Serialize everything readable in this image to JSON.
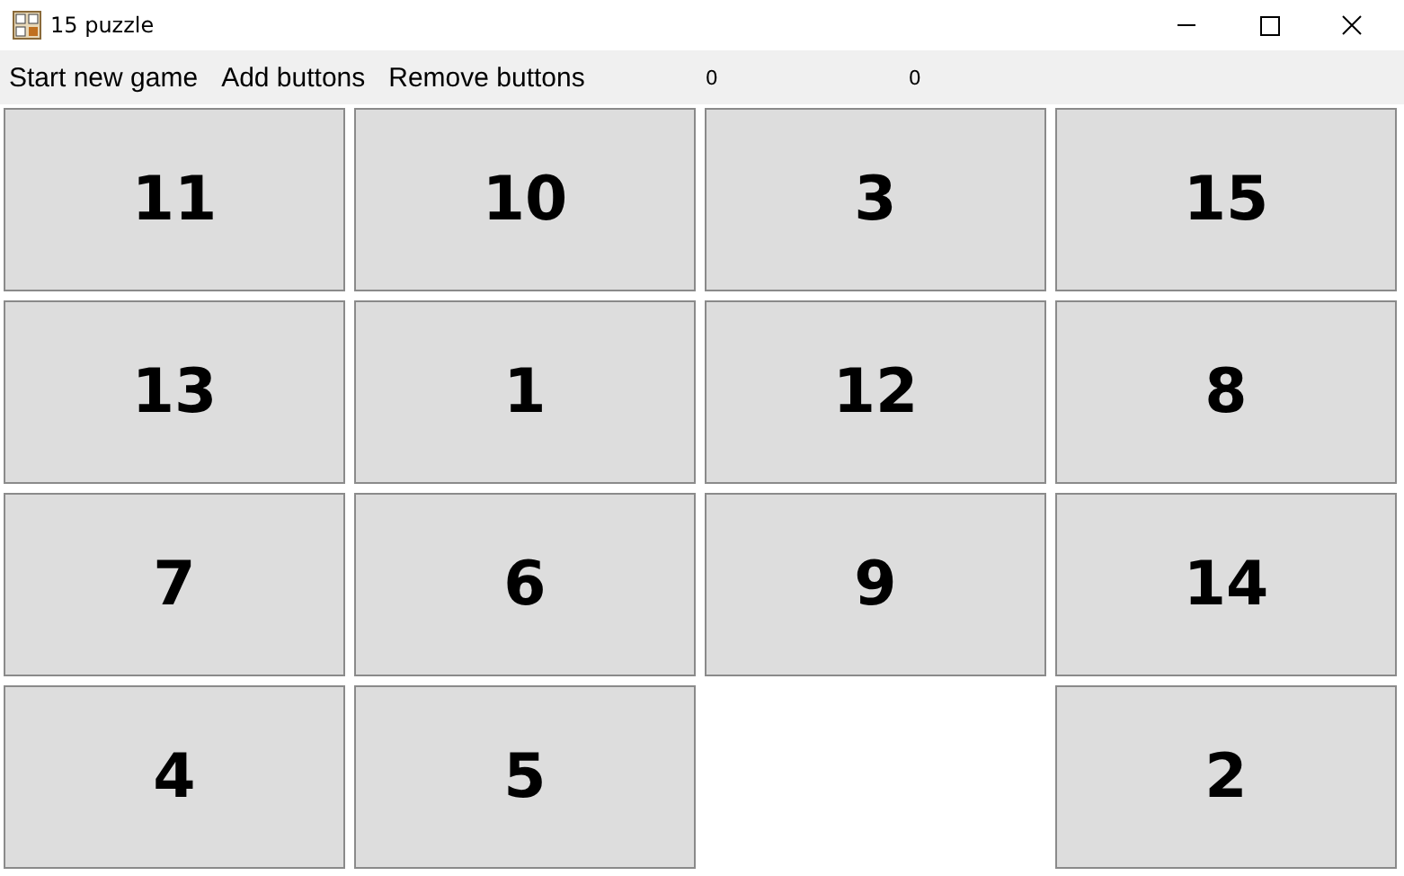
{
  "window": {
    "title": "15 puzzle"
  },
  "menu": [
    "Start new game",
    "Add buttons",
    "Remove buttons"
  ],
  "counters": [
    "0",
    "0"
  ],
  "tiles": [
    {
      "kind": "tile",
      "label": "11"
    },
    {
      "kind": "tile",
      "label": "10"
    },
    {
      "kind": "tile",
      "label": "3"
    },
    {
      "kind": "tile",
      "label": "15"
    },
    {
      "kind": "tile",
      "label": "13"
    },
    {
      "kind": "tile",
      "label": "1"
    },
    {
      "kind": "tile",
      "label": "12"
    },
    {
      "kind": "tile",
      "label": "8"
    },
    {
      "kind": "tile",
      "label": "7"
    },
    {
      "kind": "tile",
      "label": "6"
    },
    {
      "kind": "tile",
      "label": "9"
    },
    {
      "kind": "tile",
      "label": "14"
    },
    {
      "kind": "tile",
      "label": "4"
    },
    {
      "kind": "tile",
      "label": "5"
    },
    {
      "kind": "empty"
    },
    {
      "kind": "tile",
      "label": "2"
    }
  ]
}
